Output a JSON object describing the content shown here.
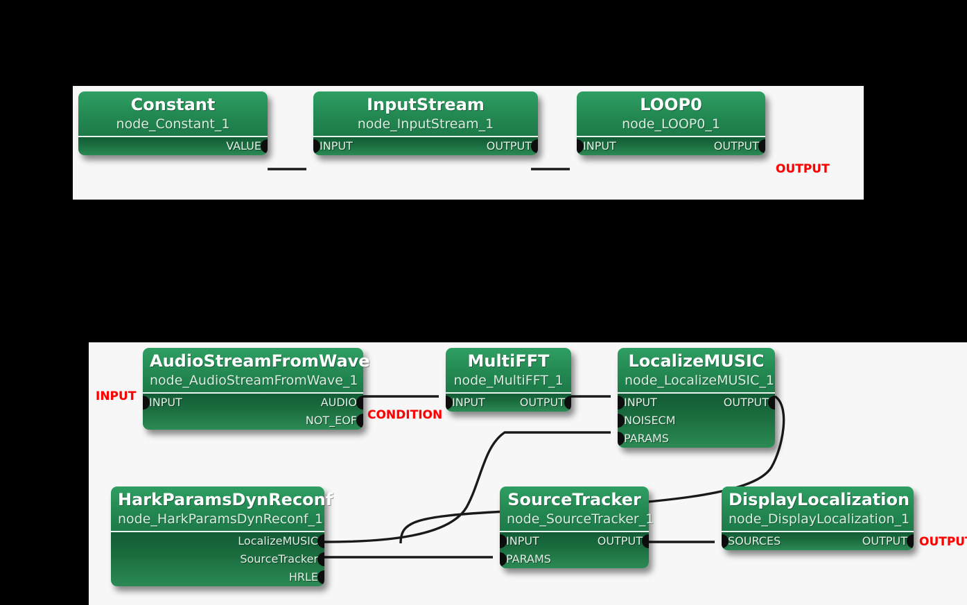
{
  "colors": {
    "canvas_background": "#f7f7f7",
    "page_background": "#000000",
    "node_header_green": "#2f9f63",
    "node_body_green": "#1a6b3e",
    "terminal_red": "#ff0000",
    "wire_black": "#1a1a1a",
    "dot_black": "#0d0d0d"
  },
  "graphs": [
    {
      "id": "main-graph",
      "nodes": [
        {
          "title": "Constant",
          "subtitle": "node_Constant_1",
          "ports": {
            "outputs": [
              "VALUE"
            ],
            "inputs": []
          }
        },
        {
          "title": "InputStream",
          "subtitle": "node_InputStream_1",
          "ports": {
            "inputs": [
              "INPUT"
            ],
            "outputs": [
              "OUTPUT"
            ]
          }
        },
        {
          "title": "LOOP0",
          "subtitle": "node_LOOP0_1",
          "ports": {
            "inputs": [
              "INPUT"
            ],
            "outputs": [
              "OUTPUT"
            ]
          }
        }
      ],
      "terminals": [
        {
          "label": "OUTPUT",
          "kind": "output"
        }
      ]
    },
    {
      "id": "loop0-graph",
      "nodes": [
        {
          "title": "AudioStreamFromWave",
          "subtitle": "node_AudioStreamFromWave_1",
          "ports": {
            "inputs": [
              "INPUT"
            ],
            "outputs": [
              "AUDIO",
              "NOT_EOF"
            ]
          }
        },
        {
          "title": "MultiFFT",
          "subtitle": "node_MultiFFT_1",
          "ports": {
            "inputs": [
              "INPUT"
            ],
            "outputs": [
              "OUTPUT"
            ]
          }
        },
        {
          "title": "LocalizeMUSIC",
          "subtitle": "node_LocalizeMUSIC_1",
          "ports": {
            "inputs": [
              "INPUT",
              "NOISECM",
              "PARAMS"
            ],
            "outputs": [
              "OUTPUT"
            ]
          }
        },
        {
          "title": "HarkParamsDynReconf",
          "subtitle": "node_HarkParamsDynReconf_1",
          "ports": {
            "inputs": [],
            "outputs": [
              "LocalizeMUSIC",
              "SourceTracker",
              "HRLE"
            ]
          }
        },
        {
          "title": "SourceTracker",
          "subtitle": "node_SourceTracker_1",
          "ports": {
            "inputs": [
              "INPUT",
              "PARAMS"
            ],
            "outputs": [
              "OUTPUT"
            ]
          }
        },
        {
          "title": "DisplayLocalization",
          "subtitle": "node_DisplayLocalization_1",
          "ports": {
            "inputs": [
              "SOURCES"
            ],
            "outputs": [
              "OUTPUT"
            ]
          }
        }
      ],
      "terminals": [
        {
          "label": "INPUT",
          "kind": "input"
        },
        {
          "label": "CONDITION",
          "kind": "condition"
        },
        {
          "label": "OUTPUT",
          "kind": "output"
        }
      ]
    }
  ]
}
